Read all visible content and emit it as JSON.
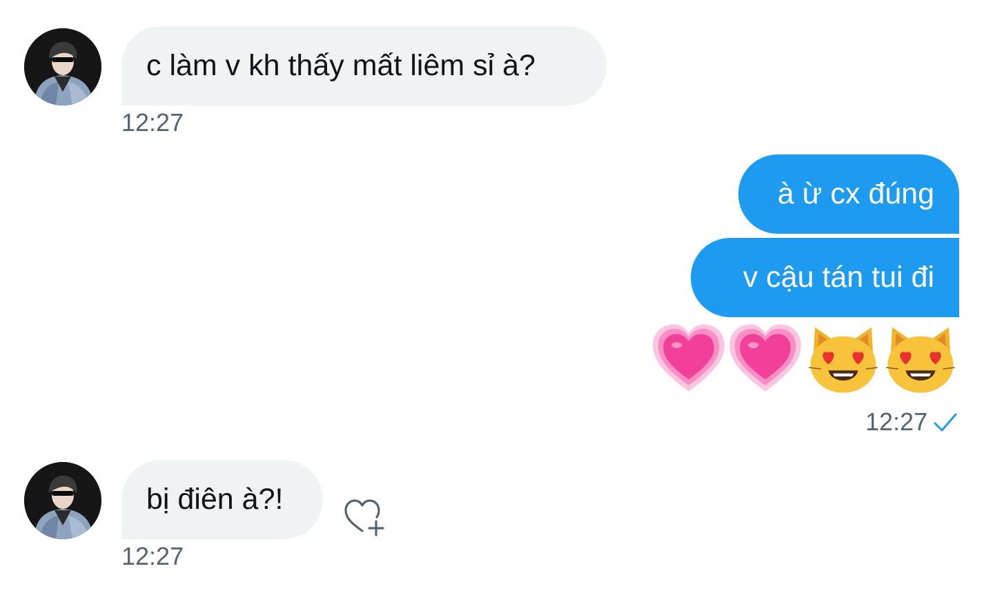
{
  "conversation": {
    "messages": [
      {
        "from": "them",
        "text": "c làm v kh thấy mất liêm sỉ à?",
        "time": "12:27"
      },
      {
        "from": "me",
        "text": "à ừ cx đúng"
      },
      {
        "from": "me",
        "text": "v cậu tán tui đi"
      },
      {
        "from": "me",
        "emojis": [
          "growing-heart-emoji",
          "growing-heart-emoji",
          "heart-eyes-cat-emoji",
          "heart-eyes-cat-emoji"
        ],
        "time": "12:27",
        "status": "sent-check-icon"
      },
      {
        "from": "them",
        "text": "bị điên à?!",
        "time": "12:27"
      }
    ]
  },
  "colors": {
    "outgoing_bubble": "#1d9bf0",
    "incoming_bubble": "#eff3f4",
    "timestamp": "#536471",
    "check": "#1d9bf0",
    "heart_pink": "#f23f9a"
  }
}
